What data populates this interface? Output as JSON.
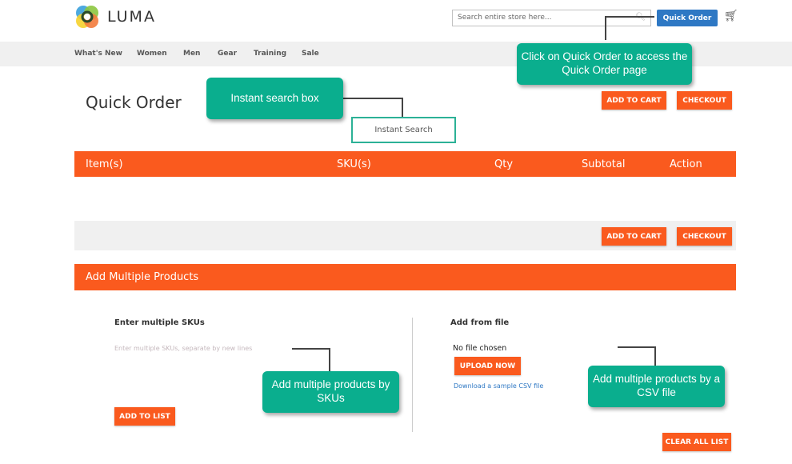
{
  "header": {
    "logo_text": "LUMA",
    "search_placeholder": "Search entire store here...",
    "quick_order_label": "Quick Order"
  },
  "nav": [
    "What's New",
    "Women",
    "Men",
    "Gear",
    "Training",
    "Sale"
  ],
  "page": {
    "title": "Quick Order",
    "add_to_cart": "ADD TO CART",
    "checkout": "CHECKOUT",
    "instant_search": "Instant Search"
  },
  "table": {
    "headers": [
      "Item(s)",
      "SKU(s)",
      "Qty",
      "Subtotal",
      "Action"
    ]
  },
  "add_multiple": {
    "title": "Add Multiple Products",
    "skus_heading": "Enter multiple SKUs",
    "skus_placeholder": "Enter multiple SKUs, separate by new lines",
    "add_to_list": "ADD TO LIST",
    "file_heading": "Add from file",
    "no_file": "No file chosen",
    "upload": "UPLOAD NOW",
    "sample_link": "Download a sample CSV file",
    "clear_all": "CLEAR ALL LIST"
  },
  "callouts": {
    "quick_order": "Click on Quick Order to access the Quick Order page",
    "instant": "Instant search box",
    "skus": "Add multiple products by SKUs",
    "csv": "Add multiple products by a CSV file"
  }
}
